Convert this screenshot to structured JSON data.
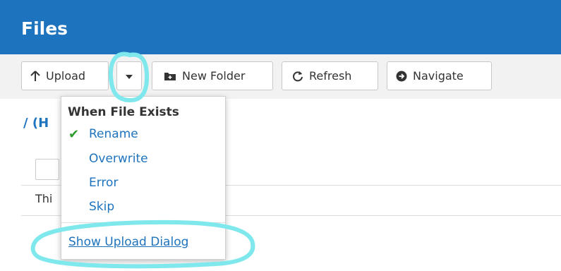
{
  "header": {
    "title": "Files"
  },
  "toolbar": {
    "upload_label": "Upload",
    "new_folder_label": "New Folder",
    "refresh_label": "Refresh",
    "navigate_label": "Navigate"
  },
  "breadcrumb": {
    "text": "/ (H"
  },
  "table": {
    "row_text": "Thi"
  },
  "menu": {
    "heading": "When File Exists",
    "items": [
      {
        "label": "Rename",
        "checked": true
      },
      {
        "label": "Overwrite",
        "checked": false
      },
      {
        "label": "Error",
        "checked": false
      },
      {
        "label": "Skip",
        "checked": false
      }
    ],
    "link": "Show Upload Dialog"
  },
  "colors": {
    "header_bg": "#1e73be",
    "link": "#1e73be",
    "check": "#2e9d2e",
    "annotation": "#7fe8ec"
  }
}
